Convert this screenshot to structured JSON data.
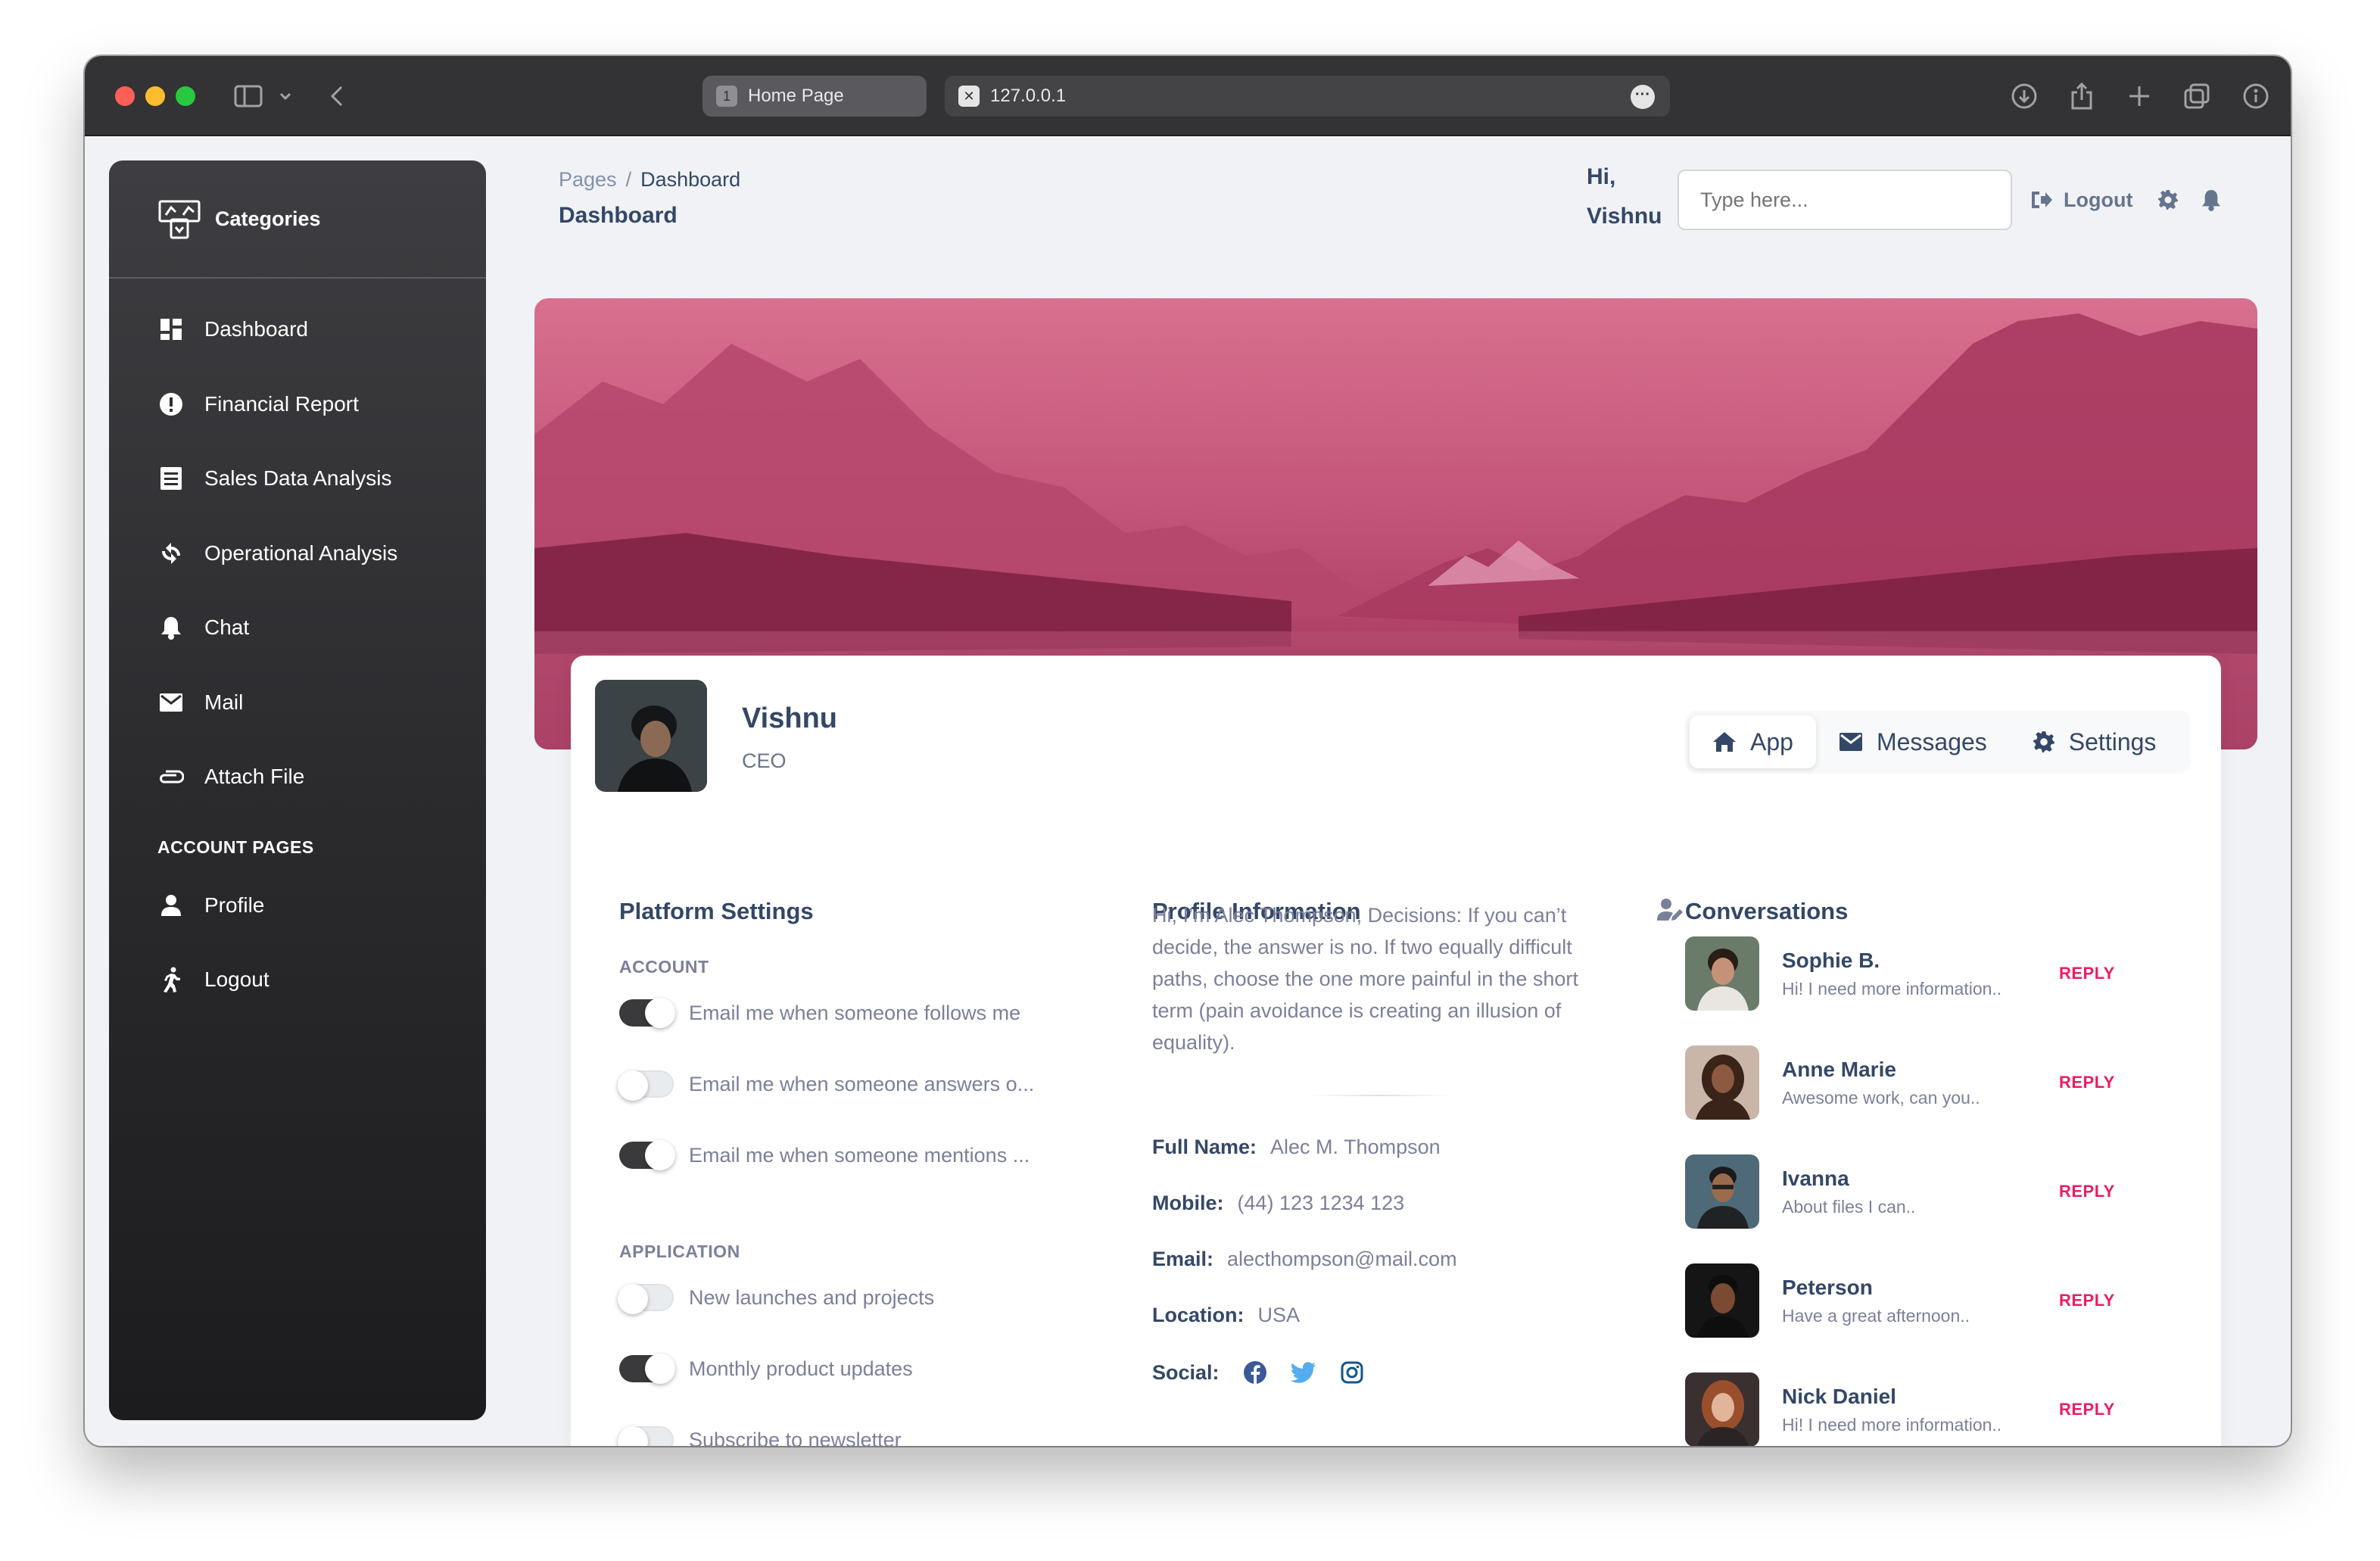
{
  "browser": {
    "tabs": [
      {
        "number": "1",
        "label": "Home Page"
      },
      {
        "label": "127.0.0.1"
      }
    ]
  },
  "sidebar": {
    "brand": "Categories",
    "items": [
      {
        "label": "Dashboard",
        "icon": "dashboard-icon"
      },
      {
        "label": "Financial Report",
        "icon": "alert-circle-icon"
      },
      {
        "label": "Sales Data Analysis",
        "icon": "receipt-icon"
      },
      {
        "label": "Operational Analysis",
        "icon": "refresh-icon"
      },
      {
        "label": "Chat",
        "icon": "bell-icon"
      },
      {
        "label": "Mail",
        "icon": "mail-icon"
      },
      {
        "label": "Attach File",
        "icon": "paperclip-icon"
      }
    ],
    "section_label": "ACCOUNT PAGES",
    "account_items": [
      {
        "label": "Profile",
        "icon": "person-icon"
      },
      {
        "label": "Logout",
        "icon": "running-person-icon"
      }
    ]
  },
  "header": {
    "breadcrumb_root": "Pages",
    "breadcrumb_sep": "/",
    "breadcrumb_current": "Dashboard",
    "page_title": "Dashboard",
    "greeting_1": "Hi,",
    "greeting_2": "Vishnu",
    "search_placeholder": "Type here...",
    "logout_label": "Logout"
  },
  "profile": {
    "name": "Vishnu",
    "role": "CEO",
    "tabs": [
      {
        "label": "App",
        "icon": "home-icon",
        "active": true
      },
      {
        "label": "Messages",
        "icon": "mail-icon",
        "active": false
      },
      {
        "label": "Settings",
        "icon": "gear-icon",
        "active": false
      }
    ]
  },
  "platform_settings": {
    "title": "Platform Settings",
    "account_label": "ACCOUNT",
    "account_toggles": [
      {
        "label": "Email me when someone follows me",
        "on": true
      },
      {
        "label": "Email me when someone answers o...",
        "on": false
      },
      {
        "label": "Email me when someone mentions ...",
        "on": true
      }
    ],
    "application_label": "APPLICATION",
    "application_toggles": [
      {
        "label": "New launches and projects",
        "on": false
      },
      {
        "label": "Monthly product updates",
        "on": true
      },
      {
        "label": "Subscribe to newsletter",
        "on": false
      }
    ]
  },
  "profile_info": {
    "title": "Profile Information",
    "bio": "Hi, I’m Alec Thompson, Decisions: If you can’t decide, the answer is no. If two equally difficult paths, choose the one more painful in the short term (pain avoidance is creating an illusion of equality).",
    "full_name_label": "Full Name:",
    "full_name": "Alec M. Thompson",
    "mobile_label": "Mobile:",
    "mobile": "(44) 123 1234 123",
    "email_label": "Email:",
    "email": "alecthompson@mail.com",
    "location_label": "Location:",
    "location": "USA",
    "social_label": "Social:",
    "social_icons": [
      "facebook-icon",
      "twitter-icon",
      "instagram-icon"
    ],
    "social_colors": {
      "facebook": "#3b5998",
      "twitter": "#55acee",
      "instagram": "#125688"
    }
  },
  "conversations": {
    "title": "Conversations",
    "reply_label": "REPLY",
    "items": [
      {
        "name": "Sophie B.",
        "message": "Hi! I need more information.."
      },
      {
        "name": "Anne Marie",
        "message": "Awesome work, can you.."
      },
      {
        "name": "Ivanna",
        "message": "About files I can.."
      },
      {
        "name": "Peterson",
        "message": "Have a great afternoon.."
      },
      {
        "name": "Nick Daniel",
        "message": "Hi! I need more information.."
      }
    ]
  },
  "colors": {
    "accent_pink": "#e91e63",
    "text_dark": "#344767",
    "text_muted": "#7b809a",
    "sidebar_bg": "#2b2b2e"
  }
}
